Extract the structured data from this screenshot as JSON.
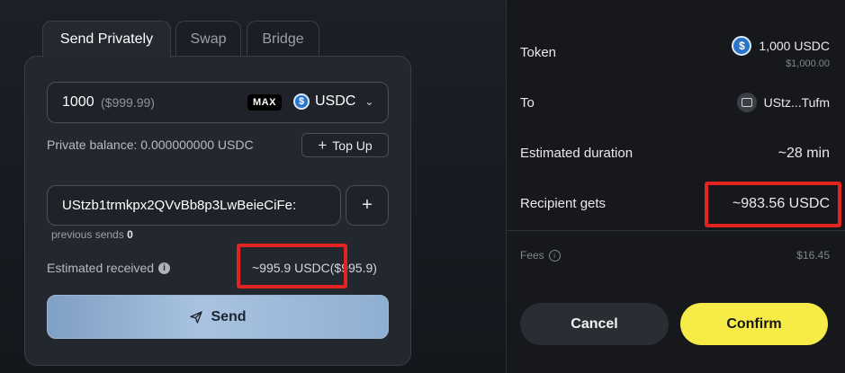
{
  "tabs": [
    {
      "label": "Send Privately",
      "active": true
    },
    {
      "label": "Swap",
      "active": false
    },
    {
      "label": "Bridge",
      "active": false
    }
  ],
  "send": {
    "amount": "1000",
    "amount_fiat": "($999.99)",
    "max_label": "MAX",
    "token_icon": "usdc-icon",
    "token": "USDC",
    "private_balance": "Private balance: 0.000000000 USDC",
    "top_up_label": "Top Up",
    "recipient": "UStzb1trmkpx2QVvBb8p3LwBeieCiFe:",
    "previous_sends_label": "previous sends",
    "previous_sends_count": "0",
    "estimated_received_label": "Estimated received",
    "estimated_received_value": "~995.9 USDC($995.9)",
    "send_label": "Send"
  },
  "confirm": {
    "token_label": "Token",
    "token_amount": "1,000 USDC",
    "token_fiat": "$1,000.00",
    "to_label": "To",
    "to_value": "UStz...Tufm",
    "duration_label": "Estimated duration",
    "duration_value": "~28 min",
    "recipient_gets_label": "Recipient gets",
    "recipient_gets_value": "~983.56 USDC",
    "fees_label": "Fees",
    "fees_value": "$16.45",
    "cancel_label": "Cancel",
    "confirm_label": "Confirm"
  },
  "colors": {
    "accent_yellow": "#f7ec47",
    "highlight_red": "#e3231f",
    "usdc_blue": "#2775ca"
  }
}
